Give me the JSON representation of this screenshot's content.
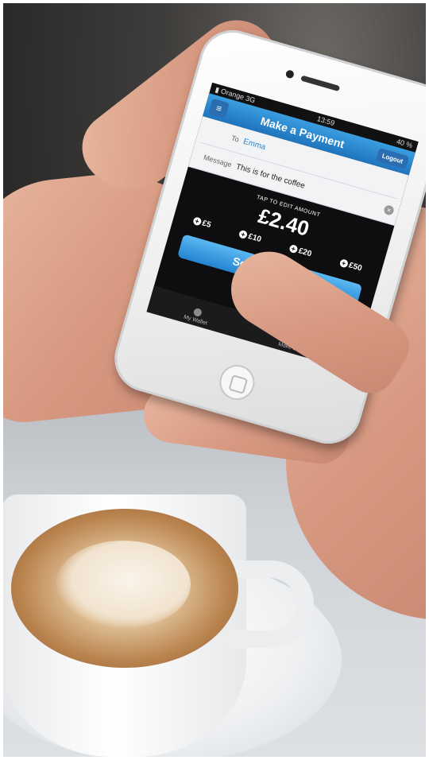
{
  "status_bar": {
    "carrier": "Orange",
    "network": "3G",
    "time": "13:59",
    "battery": "40 %"
  },
  "header": {
    "title": "Make a Payment",
    "logout_label": "Logout"
  },
  "form": {
    "to_label": "To",
    "to_value": "Emma",
    "message_label": "Message",
    "message_value": "This is for the coffee"
  },
  "amount": {
    "hint": "TAP TO EDIT AMOUNT",
    "value": "£2.40"
  },
  "quick_amounts": [
    "£5",
    "£10",
    "£20",
    "£50"
  ],
  "send_button": {
    "label": "Send Payment"
  },
  "tab_bar": {
    "items": [
      "My Wallet",
      "Make a Payment"
    ]
  },
  "colors": {
    "accent": "#2384d0",
    "screen_bg": "#0e0e10"
  }
}
